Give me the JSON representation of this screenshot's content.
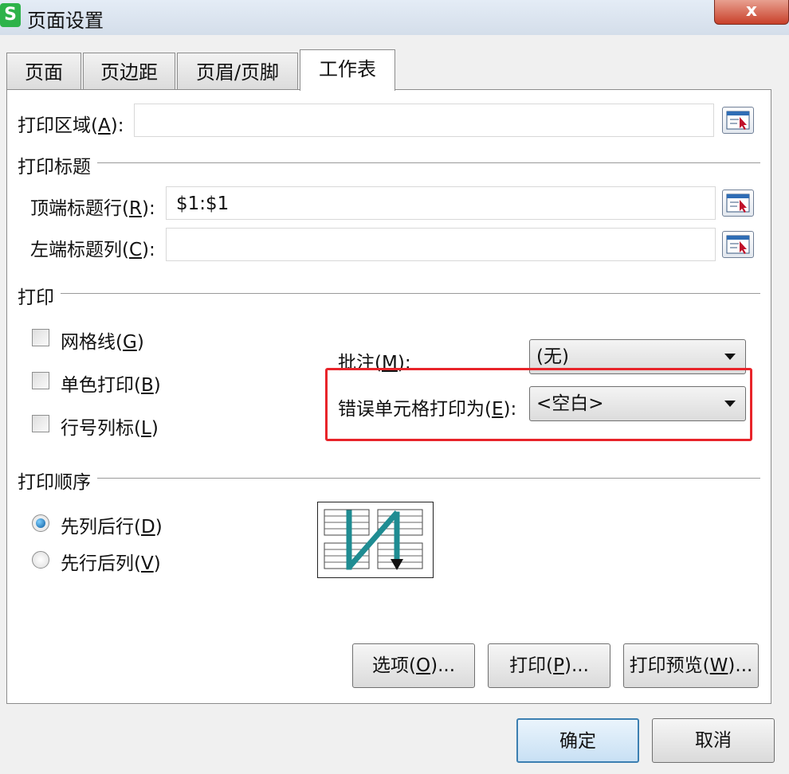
{
  "window": {
    "title": "页面设置",
    "app_icon_text": "S",
    "close_symbol": "x"
  },
  "tabs": [
    {
      "label": "页面"
    },
    {
      "label": "页边距"
    },
    {
      "label": "页眉/页脚"
    },
    {
      "label": "工作表"
    }
  ],
  "print_area": {
    "label": "打印区域",
    "hotkey": "A",
    "suffix": "):",
    "value": ""
  },
  "print_titles": {
    "section": "打印标题",
    "top_rows": {
      "label": "顶端标题行",
      "hotkey": "R",
      "suffix": "):",
      "value": "$1:$1"
    },
    "left_cols": {
      "label": "左端标题列",
      "hotkey": "C",
      "suffix": "):",
      "value": ""
    }
  },
  "print": {
    "section": "打印",
    "gridlines": {
      "label": "网格线",
      "hotkey": "G",
      "suffix": ")",
      "checked": false
    },
    "mono": {
      "label": "单色打印",
      "hotkey": "B",
      "suffix": ")",
      "checked": false
    },
    "headings": {
      "label": "行号列标",
      "hotkey": "L",
      "suffix": ")",
      "checked": false
    },
    "comments": {
      "label": "批注",
      "hotkey": "M",
      "suffix": "):",
      "value": "(无)"
    },
    "errors": {
      "label": "错误单元格打印为",
      "hotkey": "E",
      "suffix": "):",
      "value": "<空白>"
    }
  },
  "order": {
    "section": "打印顺序",
    "down_then_over": {
      "label": "先列后行",
      "hotkey": "D",
      "suffix": ")",
      "selected": true
    },
    "over_then_down": {
      "label": "先行后列",
      "hotkey": "V",
      "suffix": ")",
      "selected": false
    }
  },
  "buttons": {
    "options": {
      "label": "选项",
      "hotkey": "O",
      "suffix": ")..."
    },
    "print": {
      "label": "打印",
      "hotkey": "P",
      "suffix": ")..."
    },
    "preview": {
      "label": "打印预览",
      "hotkey": "W",
      "suffix": ")..."
    },
    "ok": "确定",
    "cancel": "取消"
  },
  "common": {
    "lparen": "("
  },
  "colors": {
    "highlight": "#e8242a",
    "order_arrow": "#1f8c92",
    "default_button": "#3c7fb1"
  }
}
